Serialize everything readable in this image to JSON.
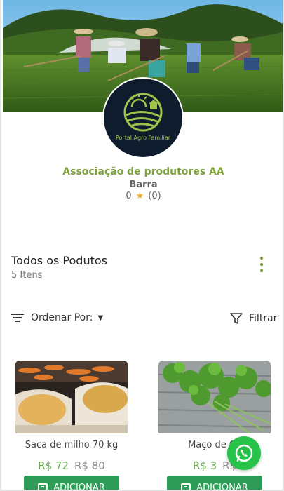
{
  "store": {
    "logo_text": "Portal Agro Familiar",
    "name": "Associação de produtores AA",
    "city": "Barra",
    "rating_value": "0",
    "rating_count": "(0)"
  },
  "products_section": {
    "title": "Todos os Podutos",
    "count": "5 Itens"
  },
  "toolbar": {
    "sort_label": "Ordenar Por:",
    "filter_label": "Filtrar"
  },
  "products": [
    {
      "name": "Saca de milho 70 kg",
      "price": "R$ 72",
      "old_price": "R$ 80",
      "add_label": "ADICIONAR"
    },
    {
      "name": "Maço de Co",
      "price": "R$ 3",
      "old_price": "R$",
      "add_label": "ADICIONAR"
    }
  ],
  "colors": {
    "accent_green": "#7ea23a",
    "button_green": "#2e9b57",
    "whatsapp_green": "#27c24a",
    "star": "#f2b01e"
  }
}
